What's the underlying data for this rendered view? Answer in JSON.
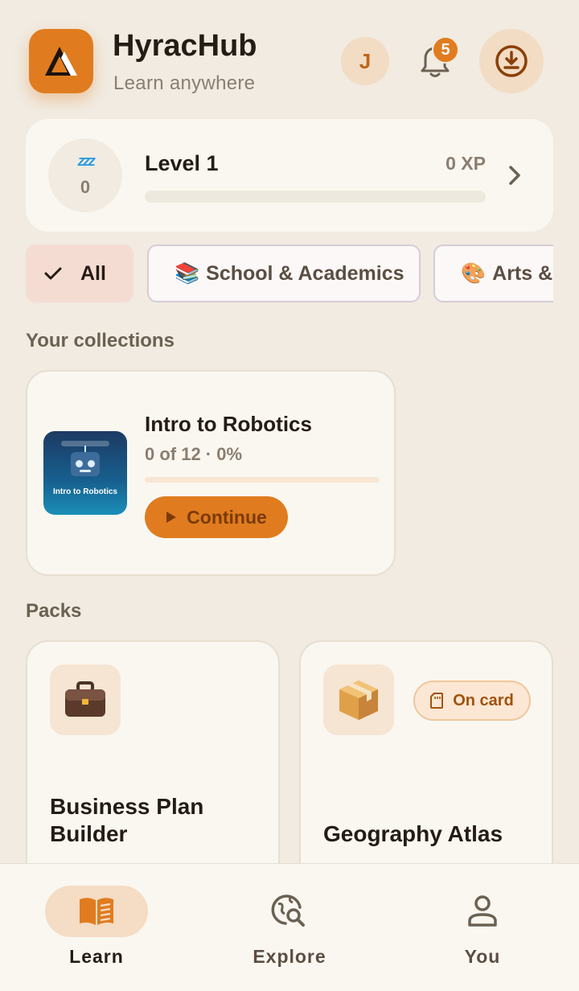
{
  "header": {
    "app_title": "HyracHub",
    "subtitle": "Learn anywhere",
    "avatar_initial": "J",
    "notification_count": "5"
  },
  "level_card": {
    "streak_count": "0",
    "level_title": "Level 1",
    "xp": "0 XP",
    "progress_fraction": 0
  },
  "chips": [
    {
      "label": "All",
      "selected": true
    },
    {
      "emoji": "📚",
      "label": "School & Academics",
      "selected": false
    },
    {
      "emoji": "🎨",
      "label": "Arts &",
      "selected": false
    }
  ],
  "collections": {
    "section_label": "Your collections",
    "items": [
      {
        "title": "Intro to Robotics",
        "meta": "0 of 12 · 0%",
        "progress_fraction": 0,
        "button_label": "Continue",
        "thumbnail_title": "Intro to Robotics"
      }
    ]
  },
  "packs": {
    "section_label": "Packs",
    "items": [
      {
        "title": "Business Plan Builder",
        "icon": "briefcase-icon"
      },
      {
        "title": "Geography Atlas",
        "icon": "package-icon",
        "badge": "On card"
      }
    ]
  },
  "bottom_nav": [
    {
      "label": "Learn",
      "icon": "book-icon",
      "active": true
    },
    {
      "label": "Explore",
      "icon": "globe-search-icon",
      "active": false
    },
    {
      "label": "You",
      "icon": "person-icon",
      "active": false
    }
  ],
  "colors": {
    "accent": "#E07C1F",
    "background": "#F1EBE1",
    "card": "#FAF7F1"
  }
}
